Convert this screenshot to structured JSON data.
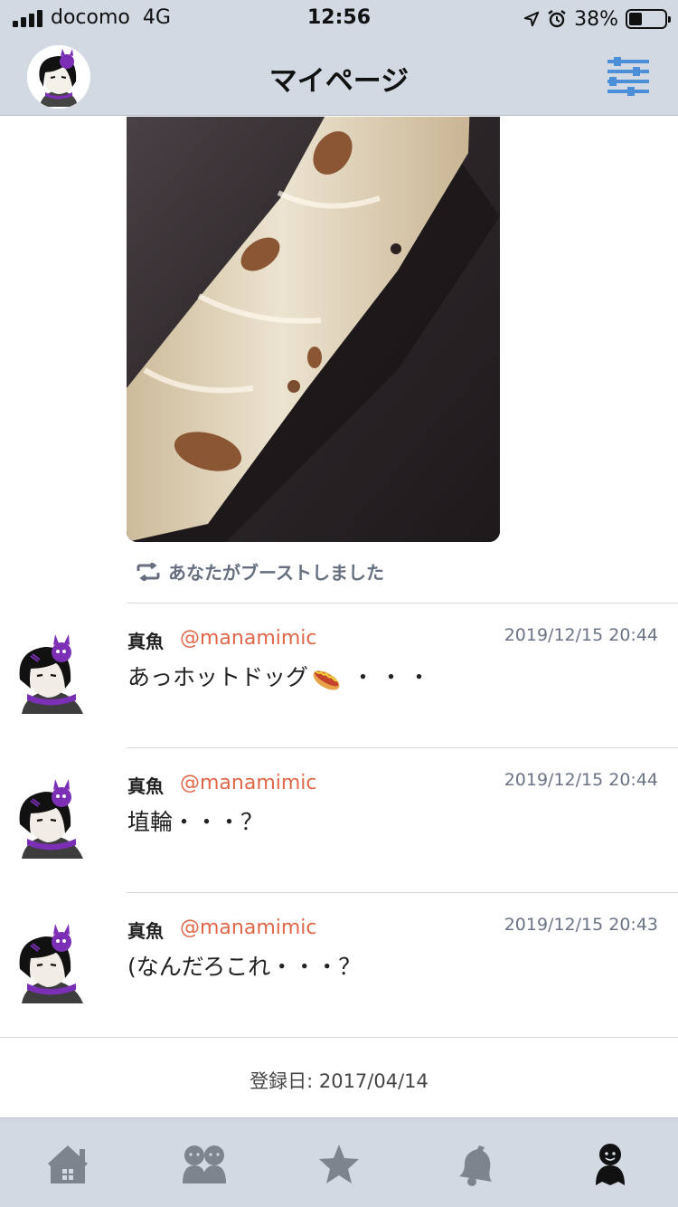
{
  "status_bar": {
    "carrier": "docomo",
    "network": "4G",
    "time": "12:56",
    "battery_percent_label": "38%",
    "battery_level": 0.38,
    "icons": [
      "signal-icon",
      "location-arrow-icon",
      "alarm-icon",
      "battery-icon"
    ]
  },
  "nav": {
    "title": "マイページ",
    "avatar_icon": "avatar",
    "settings_icon": "sliders-icon"
  },
  "boost": {
    "text": "あなたがブーストしました",
    "icon": "boost-icon"
  },
  "posts": [
    {
      "name": "真魚",
      "handle": "@manamimic",
      "time": "2019/12/15 20:44",
      "text": "あっホットドッグ",
      "text_suffix": "・・・",
      "emoji": "hotdog"
    },
    {
      "name": "真魚",
      "handle": "@manamimic",
      "time": "2019/12/15 20:44",
      "text": "埴輪・・・？"
    },
    {
      "name": "真魚",
      "handle": "@manamimic",
      "time": "2019/12/15 20:43",
      "text": "(なんだろこれ・・・？"
    }
  ],
  "registered": "登録日: 2017/04/14",
  "tabs": [
    {
      "icon": "home-icon",
      "active": false
    },
    {
      "icon": "people-icon",
      "active": false
    },
    {
      "icon": "star-icon",
      "active": false
    },
    {
      "icon": "bell-icon",
      "active": false
    },
    {
      "icon": "person-icon",
      "active": true
    }
  ],
  "colors": {
    "bar_bg": "#d2d9e2",
    "handle": "#e0674a",
    "muted": "#6b7486",
    "settings_accent": "#4a8fd8",
    "tab_inactive": "#7d848d",
    "tab_active": "#111111",
    "avatar_purple": "#7a2fb5"
  }
}
